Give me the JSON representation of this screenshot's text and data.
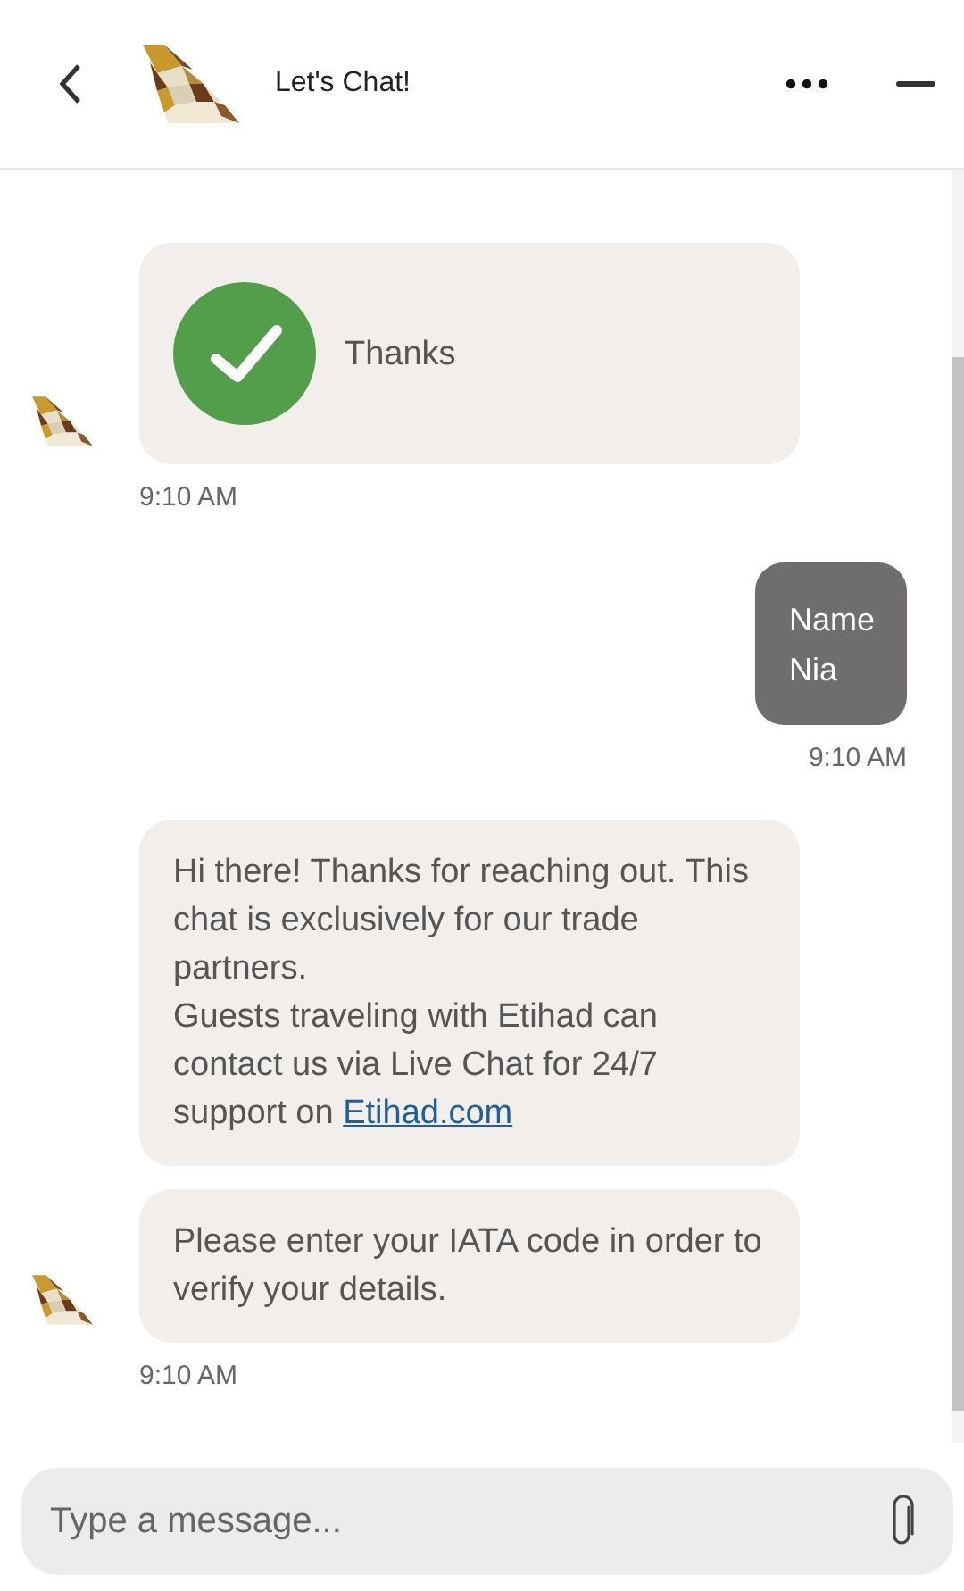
{
  "header": {
    "title": "Let's Chat!"
  },
  "messages": [
    {
      "kind": "bot",
      "bubbles": [
        {
          "kind": "check",
          "text": "Thanks"
        }
      ],
      "time": "9:10 AM"
    },
    {
      "kind": "user",
      "bubbles": [
        {
          "kind": "lines",
          "lines": [
            "Name",
            "Nia"
          ]
        }
      ],
      "time": "9:10 AM"
    },
    {
      "kind": "bot",
      "bubbles": [
        {
          "kind": "paragraphs",
          "paragraphs": [
            "Hi there! Thanks for reaching out. This chat is exclusively for our trade partners."
          ],
          "last": "Guests traveling with Etihad can contact us via Live Chat for 24/7 support on",
          "link": "Etihad.com"
        },
        {
          "kind": "paragraphs",
          "paragraphs": [
            "Please enter your IATA code in order to verify your details."
          ]
        }
      ],
      "time": "9:10 AM"
    }
  ],
  "composer": {
    "placeholder": "Type a message..."
  }
}
